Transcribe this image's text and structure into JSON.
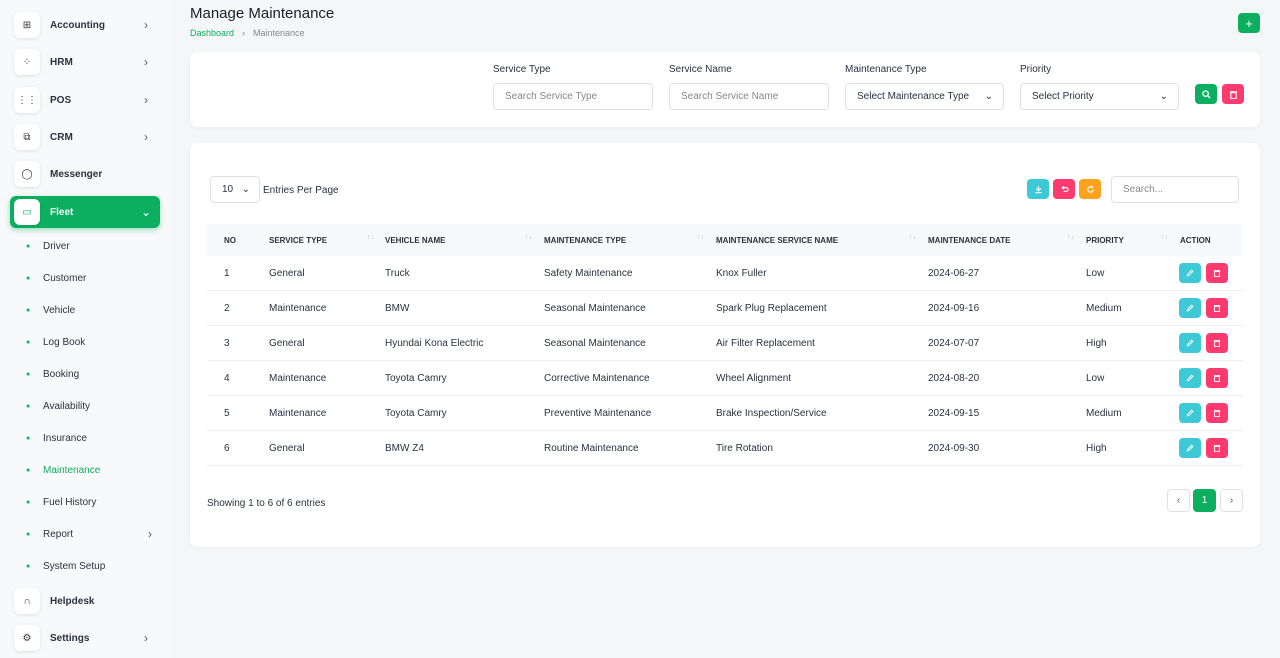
{
  "sidebar": {
    "items": [
      {
        "label": "Accounting",
        "icon": "accounting-icon",
        "glyph": "⊞",
        "chevron": "›"
      },
      {
        "label": "HRM",
        "icon": "hrm-icon",
        "glyph": "⁘",
        "chevron": "›"
      },
      {
        "label": "POS",
        "icon": "pos-icon",
        "glyph": "⋮⋮",
        "chevron": "›"
      },
      {
        "label": "CRM",
        "icon": "crm-icon",
        "glyph": "⧉",
        "chevron": "›"
      },
      {
        "label": "Messenger",
        "icon": "messenger-icon",
        "glyph": "◯",
        "chevron": ""
      },
      {
        "label": "Fleet",
        "icon": "fleet-icon",
        "glyph": "▭",
        "chevron": "⌄"
      },
      {
        "label": "Helpdesk",
        "icon": "headset-icon",
        "glyph": "∩",
        "chevron": ""
      },
      {
        "label": "Settings",
        "icon": "gear-icon",
        "glyph": "⚙",
        "chevron": "›"
      }
    ],
    "fleet_sub": [
      "Driver",
      "Customer",
      "Vehicle",
      "Log Book",
      "Booking",
      "Availability",
      "Insurance",
      "Maintenance",
      "Fuel History",
      "Report",
      "System Setup"
    ],
    "sub_chevron": "›",
    "active_sub": "Maintenance",
    "accent": "#0caf60"
  },
  "header": {
    "title": "Manage Maintenance",
    "breadcrumb": {
      "home": "Dashboard",
      "sep": "›",
      "current": "Maintenance"
    },
    "add_label": "+"
  },
  "filters": {
    "service_type": {
      "label": "Service Type",
      "placeholder": "Search Service Type"
    },
    "service_name": {
      "label": "Service Name",
      "placeholder": "Search Service Name"
    },
    "maintenance_type": {
      "label": "Maintenance Type",
      "value": "Select Maintenance Type"
    },
    "priority": {
      "label": "Priority",
      "value": "Select Priority"
    },
    "chevron": "⌄"
  },
  "table_controls": {
    "per_page": "10",
    "per_page_label": "Entries Per Page",
    "search_placeholder": "Search..."
  },
  "table": {
    "columns": [
      "NO",
      "SERVICE TYPE",
      "VEHICLE NAME",
      "MAINTENANCE TYPE",
      "MAINTENANCE SERVICE NAME",
      "MAINTENANCE DATE",
      "PRIORITY",
      "ACTION"
    ],
    "rows": [
      [
        "1",
        "General",
        "Truck",
        "Safety Maintenance",
        "Knox Fuller",
        "2024-06-27",
        "Low"
      ],
      [
        "2",
        "Maintenance",
        "BMW",
        "Seasonal Maintenance",
        "Spark Plug Replacement",
        "2024-09-16",
        "Medium"
      ],
      [
        "3",
        "General",
        "Hyundai Kona Electric",
        "Seasonal Maintenance",
        "Air Filter Replacement",
        "2024-07-07",
        "High"
      ],
      [
        "4",
        "Maintenance",
        "Toyota Camry",
        "Corrective Maintenance",
        "Wheel Alignment",
        "2024-08-20",
        "Low"
      ],
      [
        "5",
        "Maintenance",
        "Toyota Camry",
        "Preventive Maintenance",
        "Brake Inspection/Service",
        "2024-09-15",
        "Medium"
      ],
      [
        "6",
        "General",
        "BMW Z4",
        "Routine Maintenance",
        "Tire Rotation",
        "2024-09-30",
        "High"
      ]
    ]
  },
  "footer": {
    "showing": "Showing 1 to 6 of 6 entries",
    "prev": "‹",
    "page": "1",
    "next": "›"
  }
}
